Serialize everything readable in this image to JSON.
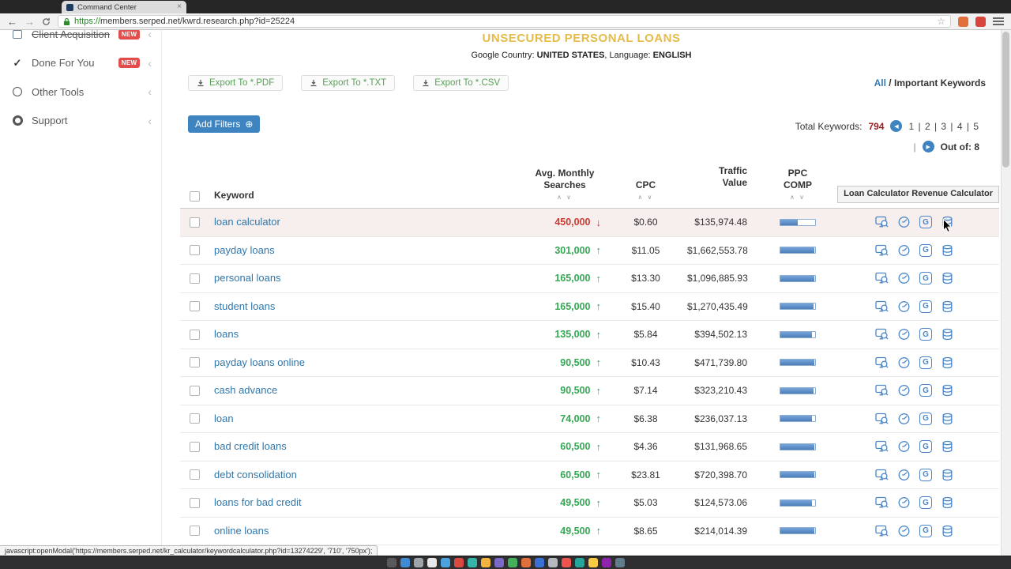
{
  "browser": {
    "tab_title": "Command Center",
    "url_scheme": "https://",
    "url_host_path": "members.serped.net/kwrd.research.php?id=25224",
    "status_text": "javascript:openModal('https://members.serped.net/kr_calculator/keywordcalculator.php?id=13274229', '710', '750px');"
  },
  "glyphs": {
    "back": "←",
    "forward": "→",
    "star": "☆",
    "close": "×",
    "chevron": "‹",
    "sort_carets": "∧ ∨",
    "plus_circle": "⊕",
    "prev_arrow": "◀",
    "next_arrow": "▶",
    "pipe": "|",
    "up_arrow": "↑",
    "down_arrow": "↓",
    "check": "✓"
  },
  "sidebar": {
    "items": [
      {
        "label": "Client Acquisition",
        "badge": "NEW"
      },
      {
        "label": "Done For You",
        "badge": "NEW"
      },
      {
        "label": "Other Tools",
        "badge": ""
      },
      {
        "label": "Support",
        "badge": ""
      }
    ]
  },
  "page": {
    "title": "UNSECURED PERSONAL LOANS",
    "country_label": "Google Country:",
    "country_value": "UNITED STATES",
    "mid_label": ", Language:",
    "language_value": "ENGLISH"
  },
  "actions": {
    "export_pdf": "Export To *.PDF",
    "export_txt": "Export To *.TXT",
    "export_csv": "Export To *.CSV",
    "add_filters": "Add Filters",
    "view_all": "All",
    "view_sep": " / ",
    "view_important": "Important Keywords"
  },
  "pagination": {
    "total_label": "Total Keywords:",
    "total_value": "794",
    "pages": [
      "1",
      "2",
      "3",
      "4",
      "5"
    ],
    "out_of_label": "Out of:",
    "out_of_value": "8"
  },
  "table": {
    "headers": {
      "keyword": "Keyword",
      "searches_line1": "Avg. Monthly",
      "searches_line2": "Searches",
      "cpc": "CPC",
      "traffic_line1": "Traffic",
      "traffic_line2": "Value",
      "ppc_line1": "PPC",
      "ppc_line2": "COMP"
    },
    "tooltip": {
      "bold": "Loan Calculator",
      "text": " Revenue Calculator"
    },
    "google_letter": "G",
    "rows": [
      {
        "keyword": "loan calculator",
        "searches": "450,000",
        "trend": "down",
        "cpc": "$0.60",
        "traffic": "$135,974.48",
        "ppc": 50
      },
      {
        "keyword": "payday loans",
        "searches": "301,000",
        "trend": "up",
        "cpc": "$11.05",
        "traffic": "$1,662,553.78",
        "ppc": 97
      },
      {
        "keyword": "personal loans",
        "searches": "165,000",
        "trend": "up",
        "cpc": "$13.30",
        "traffic": "$1,096,885.93",
        "ppc": 97
      },
      {
        "keyword": "student loans",
        "searches": "165,000",
        "trend": "up",
        "cpc": "$15.40",
        "traffic": "$1,270,435.49",
        "ppc": 95
      },
      {
        "keyword": "loans",
        "searches": "135,000",
        "trend": "up",
        "cpc": "$5.84",
        "traffic": "$394,502.13",
        "ppc": 92
      },
      {
        "keyword": "payday loans online",
        "searches": "90,500",
        "trend": "up",
        "cpc": "$10.43",
        "traffic": "$471,739.80",
        "ppc": 97
      },
      {
        "keyword": "cash advance",
        "searches": "90,500",
        "trend": "up",
        "cpc": "$7.14",
        "traffic": "$323,210.43",
        "ppc": 95
      },
      {
        "keyword": "loan",
        "searches": "74,000",
        "trend": "up",
        "cpc": "$6.38",
        "traffic": "$236,037.13",
        "ppc": 92
      },
      {
        "keyword": "bad credit loans",
        "searches": "60,500",
        "trend": "up",
        "cpc": "$4.36",
        "traffic": "$131,968.65",
        "ppc": 97
      },
      {
        "keyword": "debt consolidation",
        "searches": "60,500",
        "trend": "up",
        "cpc": "$23.81",
        "traffic": "$720,398.70",
        "ppc": 97
      },
      {
        "keyword": "loans for bad credit",
        "searches": "49,500",
        "trend": "up",
        "cpc": "$5.03",
        "traffic": "$124,573.06",
        "ppc": 92
      },
      {
        "keyword": "online loans",
        "searches": "49,500",
        "trend": "up",
        "cpc": "$8.65",
        "traffic": "$214,014.39",
        "ppc": 97
      }
    ]
  },
  "dock": {
    "icon_colors": [
      "#5a5a5c",
      "#3f8cd5",
      "#9fa4a9",
      "#e8e8ea",
      "#4aa3e0",
      "#d94a3f",
      "#35b5a9",
      "#f2b43c",
      "#7b68c8",
      "#43b05c",
      "#e2703a",
      "#3b6fd4",
      "#b5b9be",
      "#ef5350",
      "#26a69a",
      "#f9ca44",
      "#8e24aa",
      "#607d8b"
    ]
  },
  "colors": {
    "accent_blue": "#3d84c0",
    "link_blue": "#3077ab",
    "green": "#35a854",
    "red": "#cc3b33",
    "gold": "#e5bc4a",
    "badge_red": "#e24c4b"
  }
}
